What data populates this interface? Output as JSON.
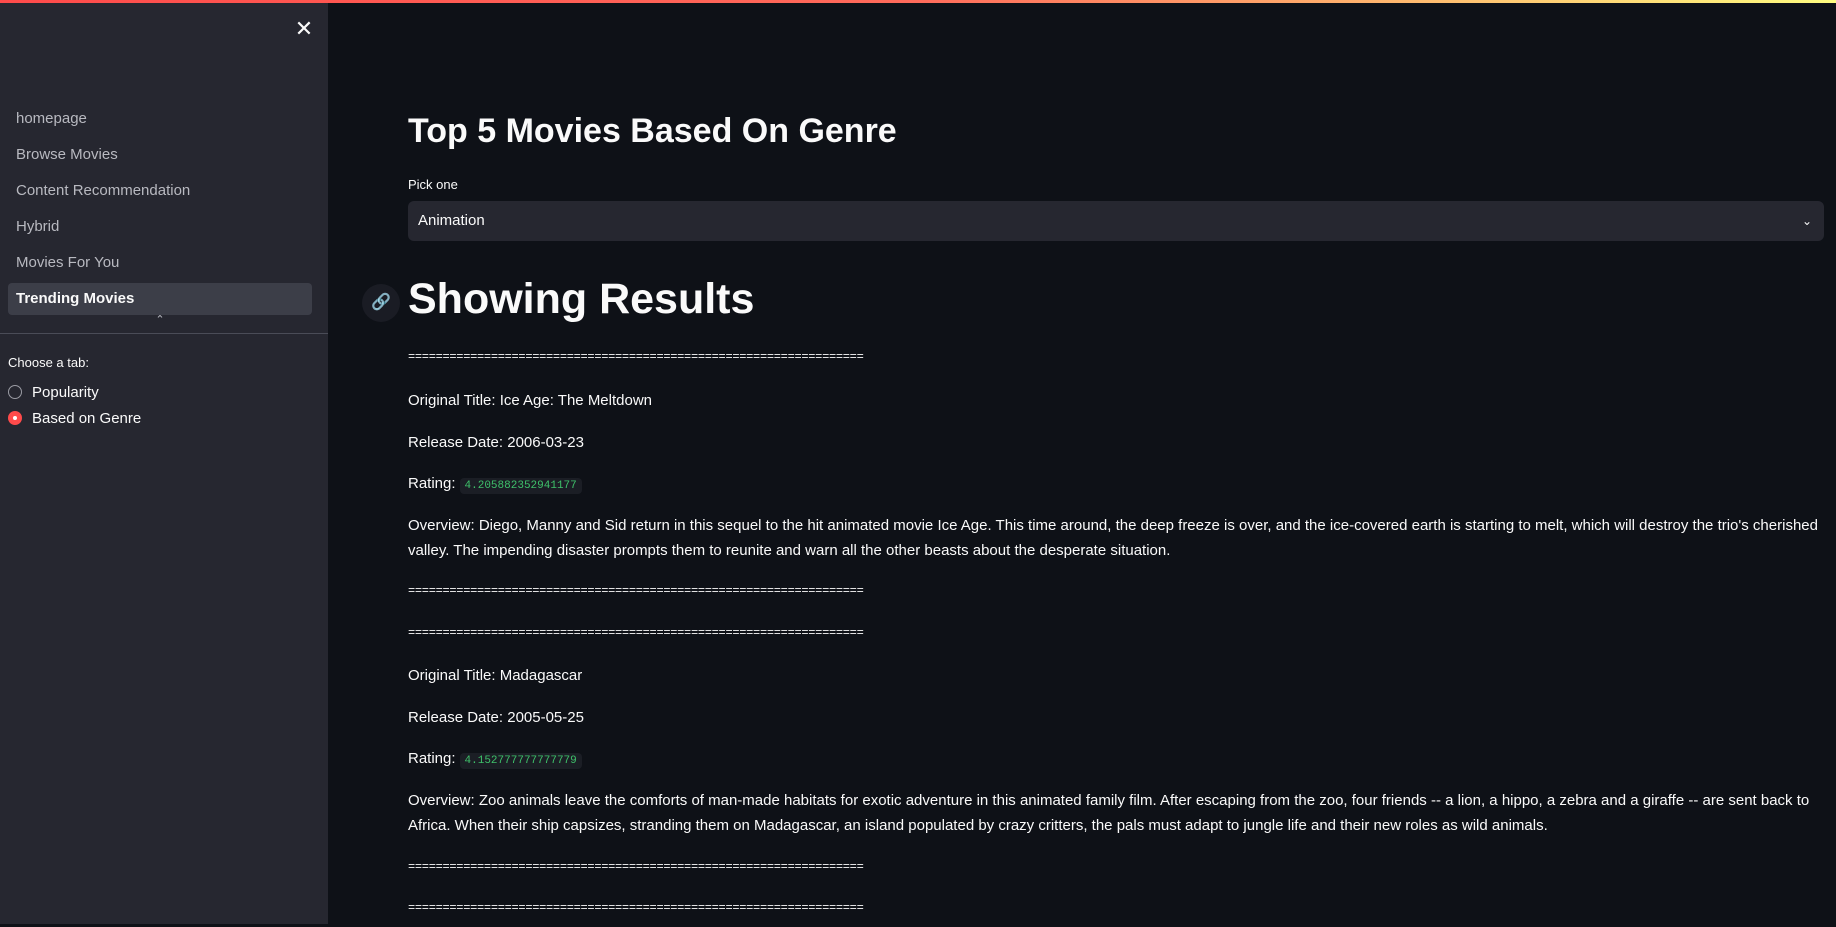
{
  "sidebar": {
    "close_glyph": "✕",
    "nav": [
      {
        "label": "homepage"
      },
      {
        "label": "Browse Movies"
      },
      {
        "label": "Content Recommendation"
      },
      {
        "label": "Hybrid"
      },
      {
        "label": "Movies For You"
      },
      {
        "label": "Trending Movies",
        "active": true
      }
    ],
    "collapse_glyph": "⌃",
    "tab_label": "Choose a tab:",
    "tabs": [
      {
        "label": "Popularity",
        "selected": false
      },
      {
        "label": "Based on Genre",
        "selected": true
      }
    ]
  },
  "main": {
    "title": "Top 5 Movies Based On Genre",
    "select_label": "Pick one",
    "select_value": "Animation",
    "chevron_glyph": "⌄",
    "link_glyph": "🔗",
    "results_heading": "Showing Results",
    "separator": "==================================================================",
    "movies": [
      {
        "original_title": "Original Title: Ice Age: The Meltdown",
        "release_date": "Release Date: 2006-03-23",
        "rating_label": "Rating:",
        "rating": "4.205882352941177",
        "overview": "Overview: Diego, Manny and Sid return in this sequel to the hit animated movie Ice Age. This time around, the deep freeze is over, and the ice-covered earth is starting to melt, which will destroy the trio's cherished valley. The impending disaster prompts them to reunite and warn all the other beasts about the desperate situation."
      },
      {
        "original_title": "Original Title: Madagascar",
        "release_date": "Release Date: 2005-05-25",
        "rating_label": "Rating:",
        "rating": "4.152777777777779",
        "overview": "Overview: Zoo animals leave the comforts of man-made habitats for exotic adventure in this animated family film. After escaping from the zoo, four friends -- a lion, a hippo, a zebra and a giraffe -- are sent back to Africa. When their ship capsizes, stranding them on Madagascar, an island populated by crazy critters, the pals must adapt to jungle life and their new roles as wild animals."
      }
    ]
  },
  "colors": {
    "background": "#0e1117",
    "sidebar": "#262730",
    "accent": "#ff4b4b",
    "code_text": "#3ec16a"
  }
}
